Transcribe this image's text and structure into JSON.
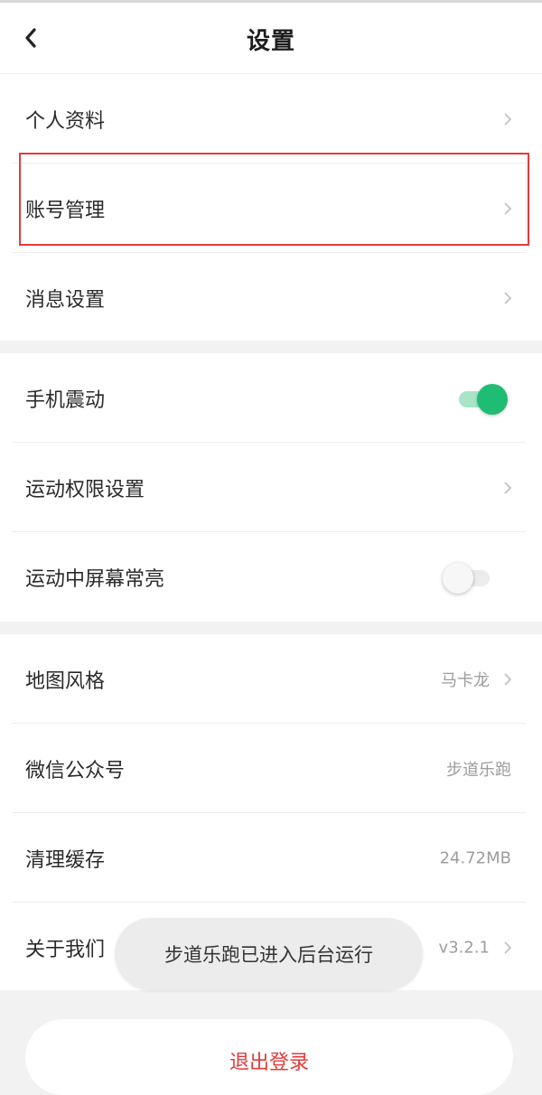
{
  "header": {
    "title": "设置"
  },
  "section1": {
    "profile": {
      "label": "个人资料"
    },
    "account": {
      "label": "账号管理"
    },
    "messages": {
      "label": "消息设置"
    }
  },
  "section2": {
    "vibration": {
      "label": "手机震动",
      "enabled": true
    },
    "permissions": {
      "label": "运动权限设置"
    },
    "screen_on": {
      "label": "运动中屏幕常亮",
      "enabled": false
    }
  },
  "section3": {
    "map_style": {
      "label": "地图风格",
      "value": "马卡龙"
    },
    "wechat": {
      "label": "微信公众号",
      "value": "步道乐跑"
    },
    "cache": {
      "label": "清理缓存",
      "value": "24.72MB"
    },
    "about": {
      "label": "关于我们",
      "value": "v3.2.1"
    }
  },
  "toast": {
    "text": "步道乐跑已进入后台运行"
  },
  "logout": {
    "label": "退出登录"
  },
  "colors": {
    "accent_green": "#1fbd73",
    "logout_red": "#e03b3b",
    "highlight_red": "#e53b3b"
  }
}
